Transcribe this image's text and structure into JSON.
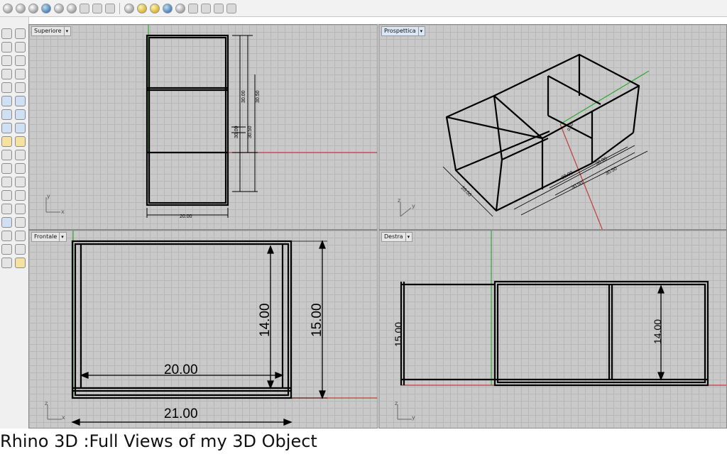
{
  "viewports": {
    "top": {
      "label": "Superiore",
      "dims": {
        "d1": "30.00",
        "d2": "30.50",
        "d3": "30.00",
        "d4": "30.50",
        "d5": "20.00",
        "axis_y": "y",
        "axis_x": "x"
      }
    },
    "perspective": {
      "label": "Prospettica",
      "dims": {
        "d1": "20.00",
        "d2": "30.00",
        "d3": "30.50",
        "d4": "30.00",
        "d5": "30.50",
        "d6": "0.50",
        "axis_z": "z",
        "axis_y": "y"
      }
    },
    "front": {
      "label": "Frontale",
      "dims": {
        "d1": "20.00",
        "d2": "14.00",
        "d3": "15.00",
        "d4": "21.00",
        "axis_z": "z",
        "axis_x": "x"
      }
    },
    "right": {
      "label": "Destra",
      "dims": {
        "d1": "15.00",
        "d2": "14.00",
        "axis_z": "z",
        "axis_y": "y"
      }
    }
  },
  "caption": "Rhino 3D :Full Views of my 3D Object",
  "colors": {
    "grid_bg": "#c9c9c9",
    "x_axis": "#c43c3c",
    "y_axis": "#2ea82e"
  }
}
